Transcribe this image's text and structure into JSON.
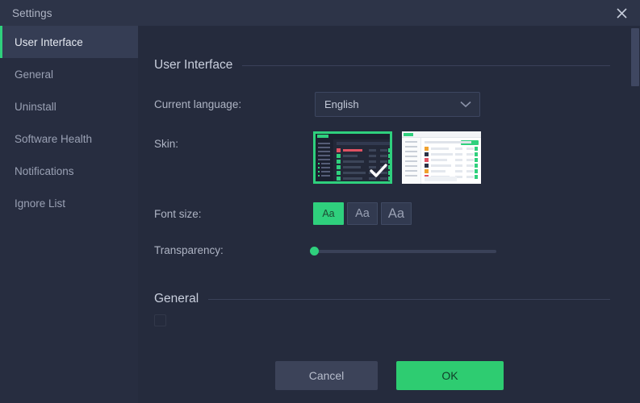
{
  "window": {
    "title": "Settings",
    "close_icon": "close-icon"
  },
  "sidebar": {
    "items": [
      {
        "label": "User Interface",
        "active": true
      },
      {
        "label": "General",
        "active": false
      },
      {
        "label": "Uninstall",
        "active": false
      },
      {
        "label": "Software Health",
        "active": false
      },
      {
        "label": "Notifications",
        "active": false
      },
      {
        "label": "Ignore List",
        "active": false
      }
    ]
  },
  "main": {
    "sections": {
      "user_interface": {
        "title": "User Interface"
      },
      "general": {
        "title": "General"
      }
    },
    "language": {
      "label": "Current language:",
      "value": "English",
      "chevron_icon": "chevron-down-icon"
    },
    "skin": {
      "label": "Skin:",
      "options": [
        {
          "name": "dark-skin",
          "selected": true
        },
        {
          "name": "light-skin",
          "selected": false
        }
      ],
      "check_icon": "check-icon"
    },
    "font_size": {
      "label": "Font size:",
      "options": [
        {
          "label": "Aa",
          "selected": true
        },
        {
          "label": "Aa",
          "selected": false
        },
        {
          "label": "Aa",
          "selected": false
        }
      ]
    },
    "transparency": {
      "label": "Transparency:",
      "value": 0,
      "min": 0,
      "max": 100
    }
  },
  "footer": {
    "cancel_label": "Cancel",
    "ok_label": "OK"
  },
  "colors": {
    "accent_green": "#2fd07d",
    "ok_button": "#2ecc71",
    "window_bg": "#252b3d",
    "sidebar_bg": "#272d40",
    "titlebar_bg": "#2d3448",
    "active_item_bg": "#353d54"
  }
}
